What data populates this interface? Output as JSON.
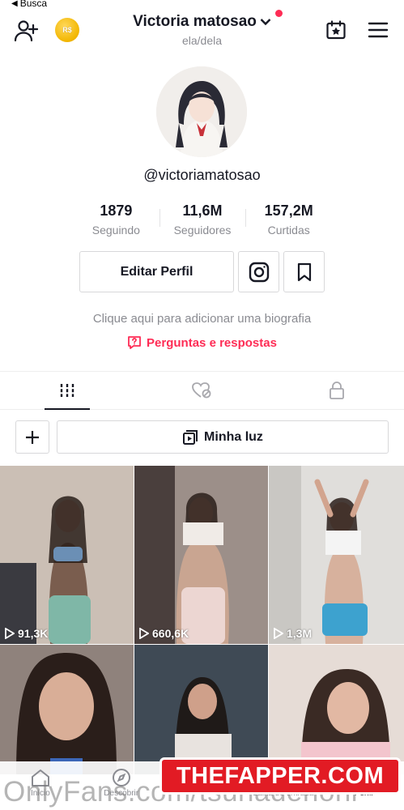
{
  "status": {
    "back_label": "Busca"
  },
  "header": {
    "title": "Victoria matosao",
    "pronouns": "ela/dela",
    "coin_label": "R$",
    "accent_color": "#fe2c55"
  },
  "profile": {
    "username": "@victoriamatosao",
    "stats": [
      {
        "value": "1879",
        "label": "Seguindo"
      },
      {
        "value": "11,6M",
        "label": "Seguidores"
      },
      {
        "value": "157,2M",
        "label": "Curtidas"
      }
    ],
    "edit_label": "Editar Perfil",
    "bio_hint": "Clique aqui para adicionar uma biografia",
    "qa_label": "Perguntas e respostas"
  },
  "tabs": [
    {
      "name": "videos",
      "icon": "grid-bars-icon",
      "active": true
    },
    {
      "name": "liked",
      "icon": "heart-hidden-icon",
      "active": false
    },
    {
      "name": "private",
      "icon": "lock-icon",
      "active": false
    }
  ],
  "secondary": {
    "minha_luz_label": "Minha luz"
  },
  "videos": [
    {
      "views": "91,3K",
      "bg": "#c8b8ad"
    },
    {
      "views": "660,6K",
      "bg": "#a79890"
    },
    {
      "views": "1,3M",
      "bg": "#dcdad6"
    },
    {
      "views": "",
      "bg": "#8d7f78"
    },
    {
      "views": "",
      "bg": "#3f4a55"
    },
    {
      "views": "",
      "bg": "#e4d6cf"
    }
  ],
  "nav": [
    {
      "label": "Início",
      "icon": "home-icon"
    },
    {
      "label": "Descobrir",
      "icon": "compass-icon"
    },
    {
      "label": "",
      "icon": "create-icon"
    },
    {
      "label": "Caixa de entrada",
      "icon": "inbox-icon"
    },
    {
      "label": "Perfil",
      "icon": "profile-icon"
    }
  ],
  "watermarks": {
    "banner": "THEFAPPER.COM",
    "text": "OnlyFans.com/tsunadenoni"
  }
}
